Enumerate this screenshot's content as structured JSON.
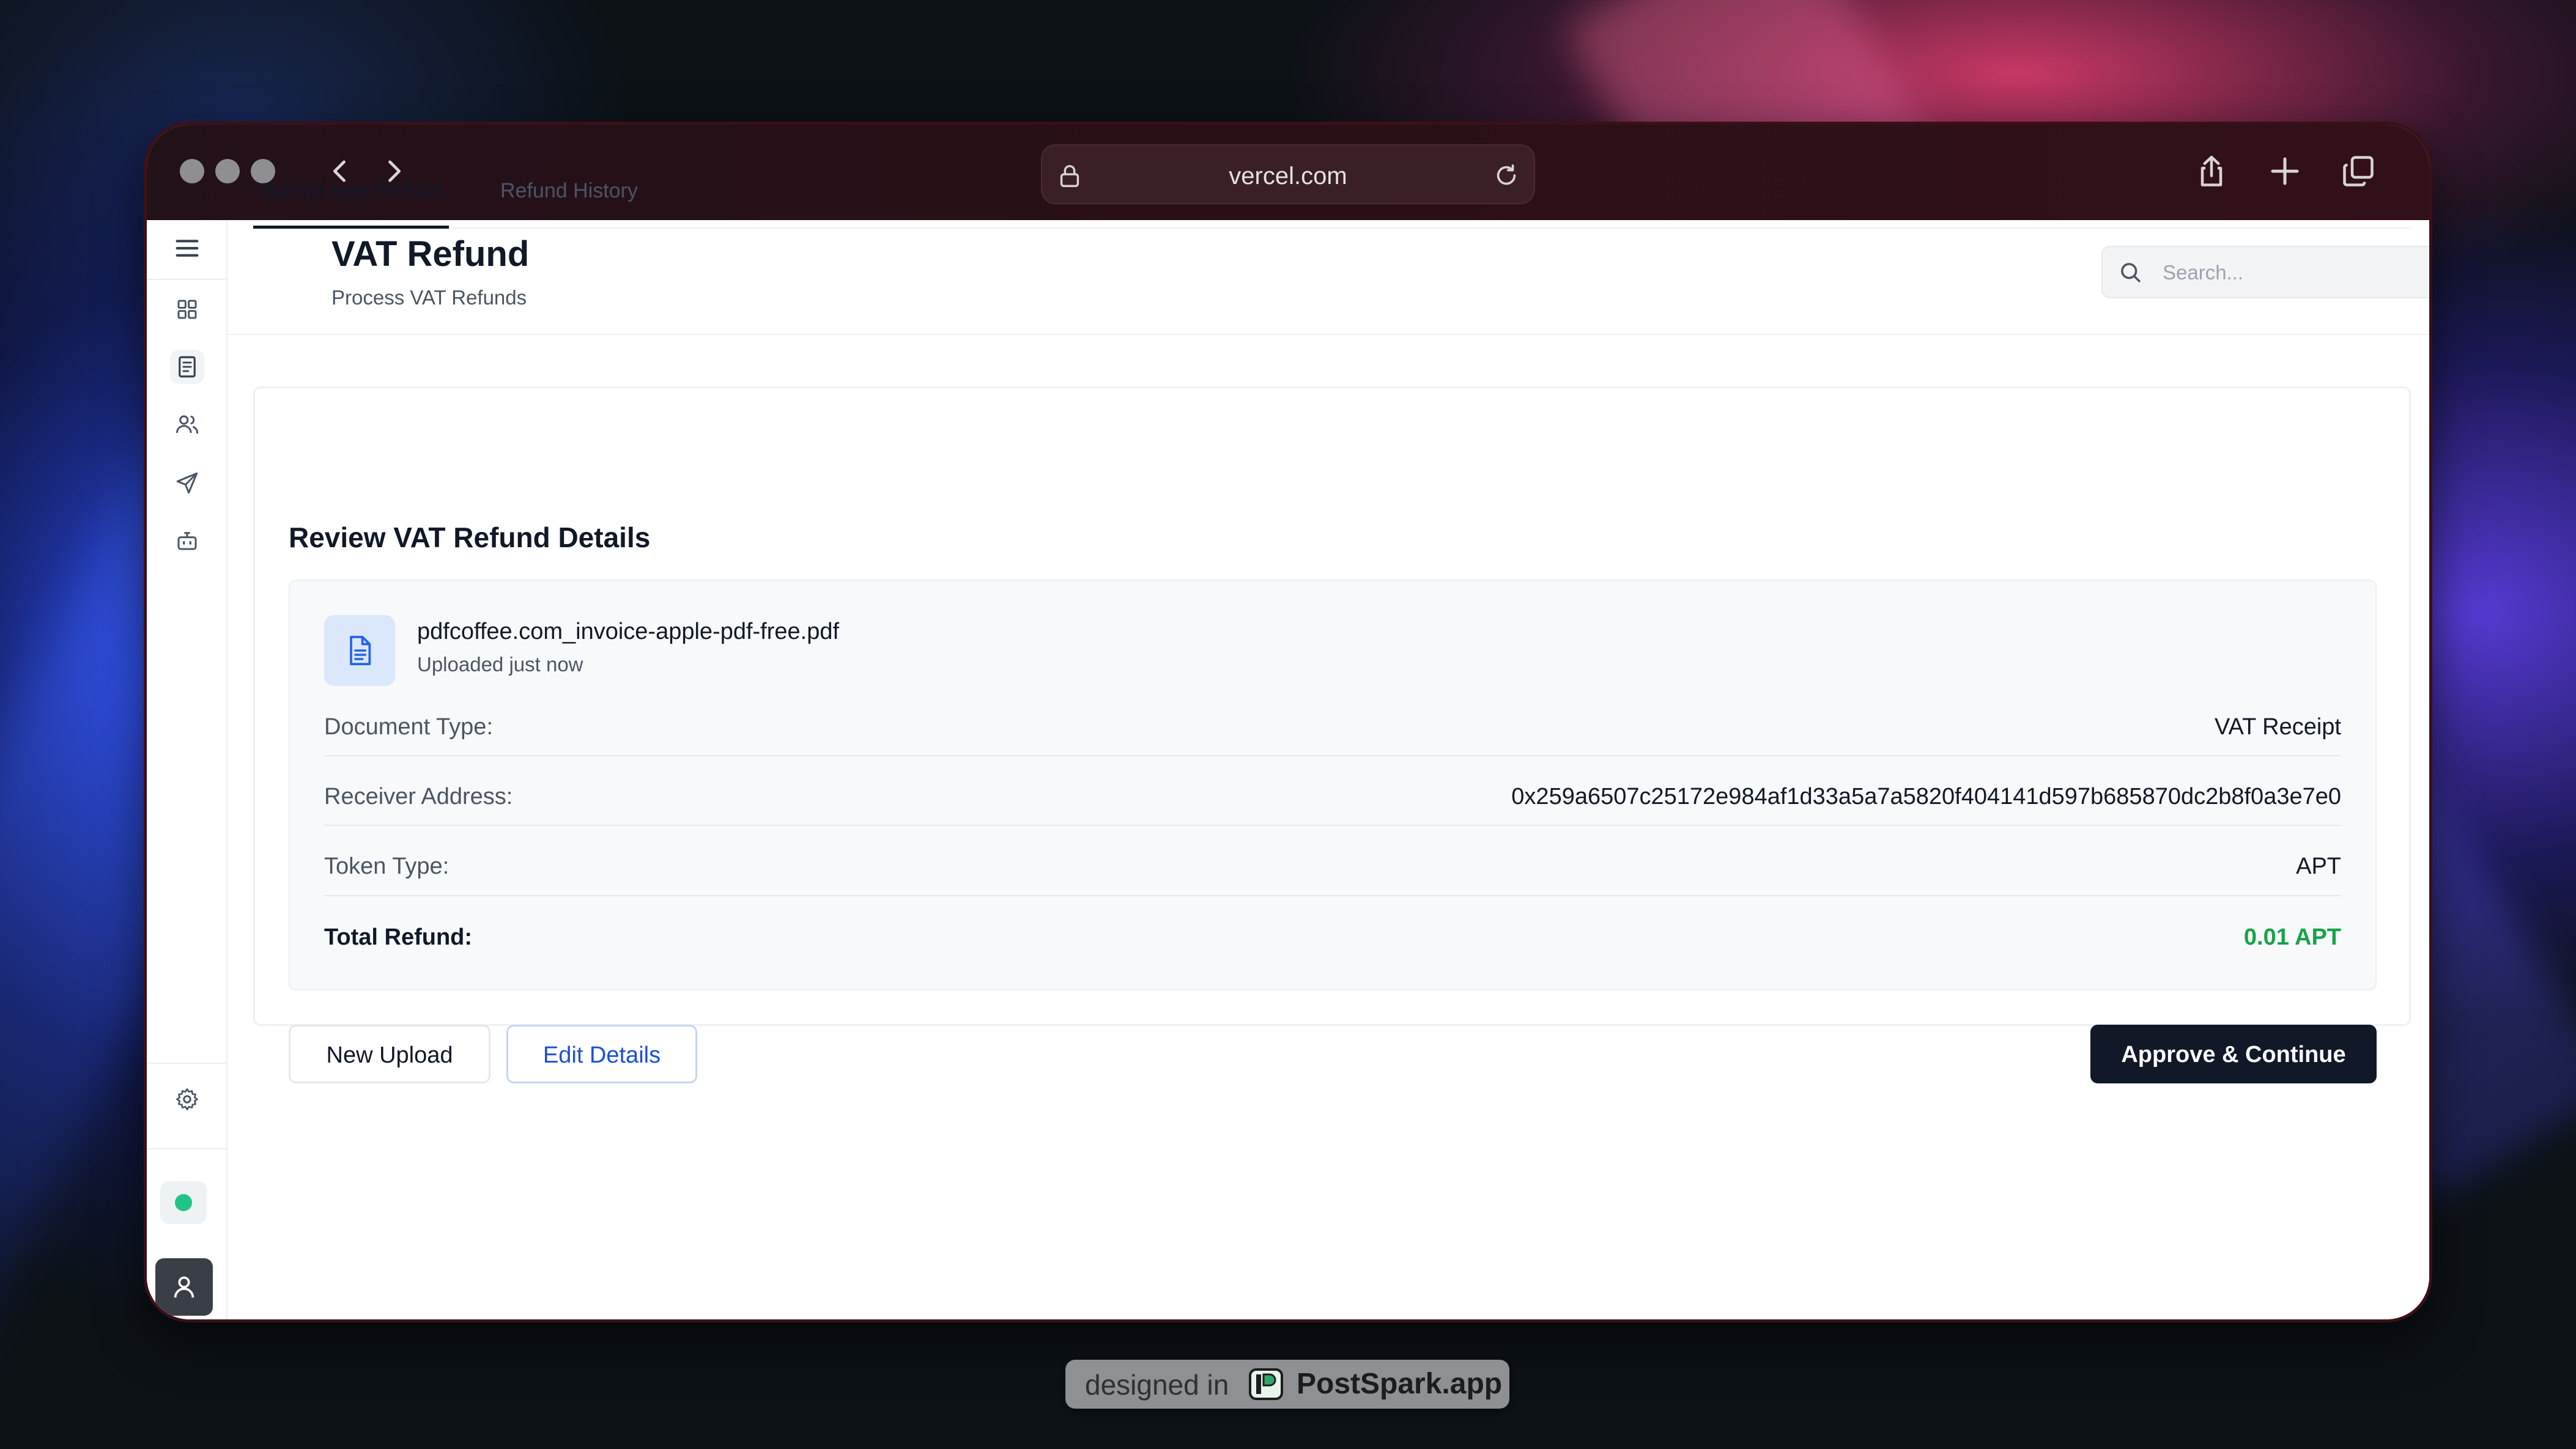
{
  "browser": {
    "url": "vercel.com",
    "icons": [
      "back-icon",
      "forward-icon",
      "lock-icon",
      "reload-icon",
      "share-icon",
      "new-tab-icon",
      "tabs-overview-icon"
    ]
  },
  "sidebar": {
    "items": [
      {
        "name": "menu",
        "icon": "hamburger-menu-icon"
      },
      {
        "name": "dashboard",
        "icon": "grid-icon"
      },
      {
        "name": "refunds",
        "icon": "receipt-icon",
        "active": true
      },
      {
        "name": "users",
        "icon": "users-icon"
      },
      {
        "name": "send",
        "icon": "send-icon"
      },
      {
        "name": "bot",
        "icon": "bot-icon"
      },
      {
        "name": "settings",
        "icon": "gear-icon"
      }
    ],
    "status_color": "#22c387"
  },
  "header": {
    "title": "VAT Refund",
    "subtitle": "Process VAT Refunds",
    "search_placeholder": "Search..."
  },
  "tabs": [
    {
      "label": "Submit New Refund",
      "active": true
    },
    {
      "label": "Refund History",
      "active": false
    }
  ],
  "review": {
    "title": "Review VAT Refund Details",
    "file": {
      "name": "pdfcoffee.com_invoice-apple-pdf-free.pdf",
      "status": "Uploaded just now"
    },
    "rows": [
      {
        "label": "Document Type:",
        "value": "VAT Receipt"
      },
      {
        "label": "Receiver Address:",
        "value": "0x259a6507c25172e984af1d33a5a7a5820f404141d597b685870dc2b8f0a3e7e0"
      },
      {
        "label": "Token Type:",
        "value": "APT"
      },
      {
        "label": "Total Refund:",
        "value": "0.01 APT"
      }
    ],
    "total_color": "#16a34a"
  },
  "actions": {
    "new_upload": "New Upload",
    "edit_details": "Edit Details",
    "approve": "Approve & Continue"
  },
  "badge": {
    "prefix": "designed in",
    "brand": "PostSpark.app"
  }
}
